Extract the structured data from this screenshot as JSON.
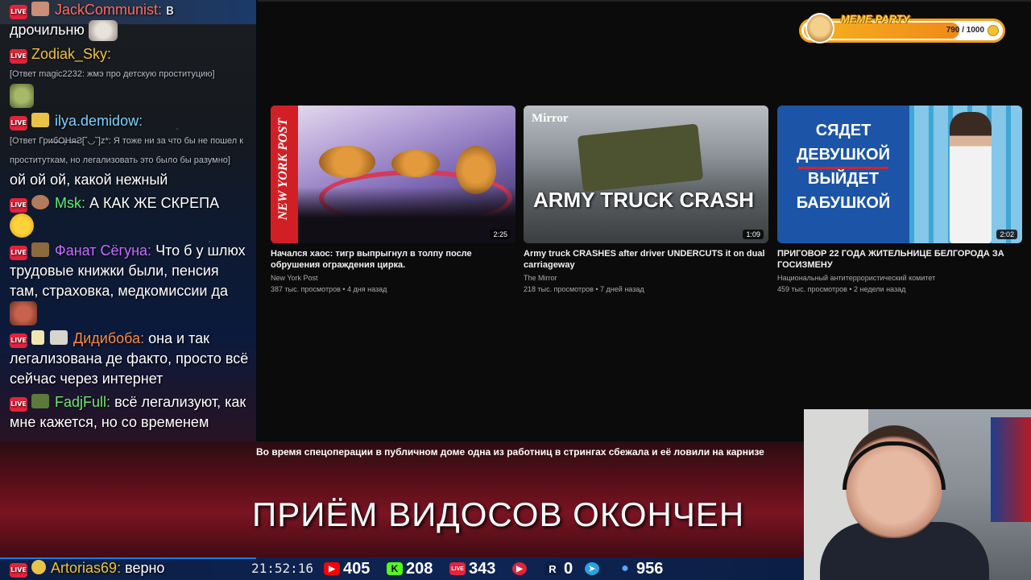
{
  "chat": {
    "messages": [
      {
        "user": "JackCommunist:",
        "color": "#ff6b5e",
        "text": "в дрочильню",
        "reply": ""
      },
      {
        "user": "Zodiak_Sky:",
        "color": "#f1c232",
        "text": "",
        "reply": "[Ответ magic2232: жмэ про детскую проституцию]"
      },
      {
        "user": "ilya.demidow:",
        "color": "#7cd0ff",
        "text": "ой ой ой, какой нежный",
        "reply": "[Ответ Гри̶б̶О̶̶͕Н̶я̶Ϩ[˘◡˘]z*: Я тоже ни за что бы не пошел к проституткам, но легализовать это было бы разумно]"
      },
      {
        "user": "Msk:",
        "color": "#5ef07a",
        "text": "А КАК ЖЕ СКРЕПА",
        "reply": ""
      },
      {
        "user": "Фанат Сёгуна:",
        "color": "#c86bff",
        "text": "Что б у шлюх трудовые книжки были, пенсия там, страховка, медкомиссии да",
        "reply": ""
      },
      {
        "user": "Дидибоба:",
        "color": "#ff8a3d",
        "text": "она и так легализована де факто, просто всё сейчас через интернет",
        "reply": ""
      },
      {
        "user": "FadjFull:",
        "color": "#6fe86f",
        "text": "всё легализуют, как мне кажется, но со временем",
        "reply": ""
      },
      {
        "user": "Artorias69:",
        "color": "#f1c232",
        "text": "верно",
        "reply": ""
      }
    ]
  },
  "live_badge": "LIVE",
  "videos": [
    {
      "title": "Начался хаос: тигр выпрыгнул в толпу после обрушения ограждения цирка.",
      "channel": "New York Post",
      "meta": "387 тыс. просмотров • 4 дня назад",
      "duration": "2:25",
      "thumb_text": "NEW YORK POST"
    },
    {
      "title": "Army truck CRASHES after driver UNDERCUTS it on dual carriageway",
      "channel": "The Mirror",
      "meta": "218 тыс. просмотров • 7 дней назад",
      "duration": "1:09",
      "thumb_text": "ARMY TRUCK CRASH",
      "thumb_brand": "Mirror"
    },
    {
      "title": "ПРИГОВОР 22 ГОДА ЖИТЕЛЬНИЦЕ БЕЛГОРОДА ЗА ГОСИЗМЕНУ",
      "channel": "Национальный антитеррористический комитет",
      "meta": "459 тыс. просмотров • 2 недели назад",
      "duration": "2:02",
      "thumb_lines": [
        "СЯДЕТ",
        "ДЕВУШКОЙ",
        "ВЫЙДЕТ",
        "БАБУШКОЙ"
      ]
    }
  ],
  "meme_party": {
    "title": "MEME PARTY",
    "score": "790 / 1000",
    "progress": 0.79
  },
  "ticker": "Во время спецоперации в публичном доме одна из работниц в стрингах сбежала и её ловили на карнизе",
  "banner": "ПРИЁМ ВИДОСОВ ОКОНЧЕН",
  "status": {
    "clock": "21:52:16",
    "youtube": "405",
    "kick": "208",
    "vk": "343",
    "rutube": "",
    "r": "0",
    "telegram": "",
    "viewers": "956"
  },
  "colors": {
    "live": "#e3233a",
    "accent": "#f0a31c",
    "youtube": "#ff0000",
    "kick": "#53fc18",
    "telegram": "#2aa3e0",
    "vkplay": "#0077ff"
  }
}
